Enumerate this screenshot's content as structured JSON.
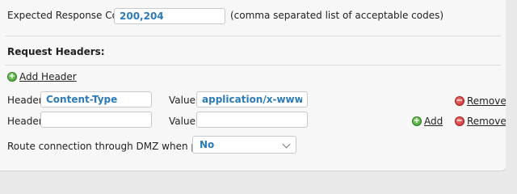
{
  "expected_codes": {
    "label": "Expected Response Codes:",
    "value": "200,204",
    "hint": "(comma separated list of acceptable codes)"
  },
  "request_headers": {
    "title": "Request Headers:",
    "add_header_label": "Add Header",
    "header_label": "Header:",
    "value_label": "Value:",
    "add_label": "Add",
    "remove_label": "Remove",
    "rows": [
      {
        "header": "Content-Type",
        "value": "application/x-www-form"
      },
      {
        "header": "",
        "value": ""
      }
    ]
  },
  "dmz": {
    "label": "Route connection through DMZ when possible:",
    "selected": "No"
  },
  "icons": {
    "add": "plus-circle-icon",
    "remove": "minus-circle-icon"
  },
  "colors": {
    "input_text": "#2b7bb9",
    "add_icon": "#3f9b2f",
    "remove_icon": "#c52b2b"
  }
}
